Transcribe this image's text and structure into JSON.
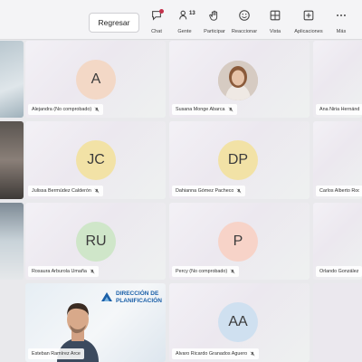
{
  "toolbar": {
    "back_label": "Regresar",
    "items": [
      {
        "label": "Chat",
        "icon": "chat-icon"
      },
      {
        "label": "Gente",
        "icon": "people-icon",
        "count": "13"
      },
      {
        "label": "Participar",
        "icon": "raise-hand-icon"
      },
      {
        "label": "Reaccionar",
        "icon": "smile-icon"
      },
      {
        "label": "Vista",
        "icon": "grid-view-icon"
      },
      {
        "label": "Aplicaciones",
        "icon": "add-apps-icon"
      },
      {
        "label": "Más",
        "icon": "more-icon"
      }
    ]
  },
  "participants": [
    {
      "name": "Alejandra (No comprobado)",
      "initials": "A",
      "avatar_color": "#f3d8c6"
    },
    {
      "name": "Susana Monge Abarca",
      "photo": true
    },
    {
      "name": "Ana Niria Hernández",
      "partial": true
    },
    {
      "name": "Julissa Bermúdez Calderón",
      "initials": "JC",
      "avatar_color": "#f2e2a6"
    },
    {
      "name": "Dahianna Gómez Pacheco",
      "initials": "DP",
      "avatar_color": "#f2e2a6"
    },
    {
      "name": "Carlos Alberto Rodríguez",
      "partial": true
    },
    {
      "name": "Rosaura Arburola Umaña",
      "initials": "RU",
      "avatar_color": "#cfe6c9"
    },
    {
      "name": "Percy (No comprobado)",
      "initials": "P",
      "avatar_color": "#f7d3c8"
    },
    {
      "name": "Orlando González",
      "partial": true
    },
    {
      "name": "Esteban Ramírez Arce",
      "video": true,
      "banner_line1": "DIRECCIÓN DE",
      "banner_line2": "PLANIFICACIÓN"
    },
    {
      "name": "Alvaro Ricardo Granados Aguero",
      "initials": "AA",
      "avatar_color": "#cfe0f0"
    }
  ],
  "colors": {
    "accent": "#4f52b2",
    "badge": "#c4314b",
    "banner_blue": "#1a5fa8"
  }
}
